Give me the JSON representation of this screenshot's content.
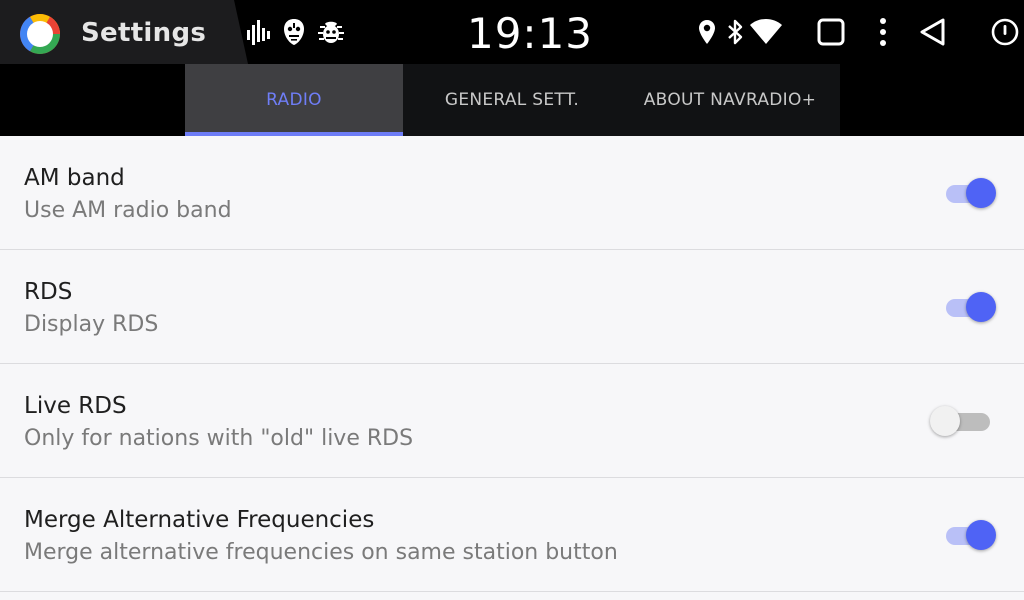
{
  "status_bar": {
    "app_title": "Settings",
    "clock": "19:13",
    "notification_icons": [
      "equalizer-icon",
      "tribal-mask-icon",
      "bug-icon"
    ],
    "system_icons": [
      "location-icon",
      "bluetooth-icon",
      "wifi-icon",
      "recents-square-icon",
      "more-vertical-icon",
      "back-triangle-icon",
      "power-icon"
    ]
  },
  "tabs": [
    {
      "label": "RADIO",
      "active": true
    },
    {
      "label": "GENERAL SETT.",
      "active": false
    },
    {
      "label": "ABOUT NAVRADIO+",
      "active": false
    }
  ],
  "settings": [
    {
      "title": "AM band",
      "subtitle": "Use AM radio band",
      "enabled": true
    },
    {
      "title": "RDS",
      "subtitle": "Display RDS",
      "enabled": true
    },
    {
      "title": "Live RDS",
      "subtitle": "Only for nations with \"old\" live RDS",
      "enabled": false
    },
    {
      "title": "Merge Alternative Frequencies",
      "subtitle": "Merge alternative frequencies on same station button",
      "enabled": true
    }
  ],
  "colors": {
    "accent": "#4f63f5",
    "accent_track": "#b9c0f7",
    "tab_active_text": "#6f7ef7",
    "background": "#f7f7f9"
  }
}
